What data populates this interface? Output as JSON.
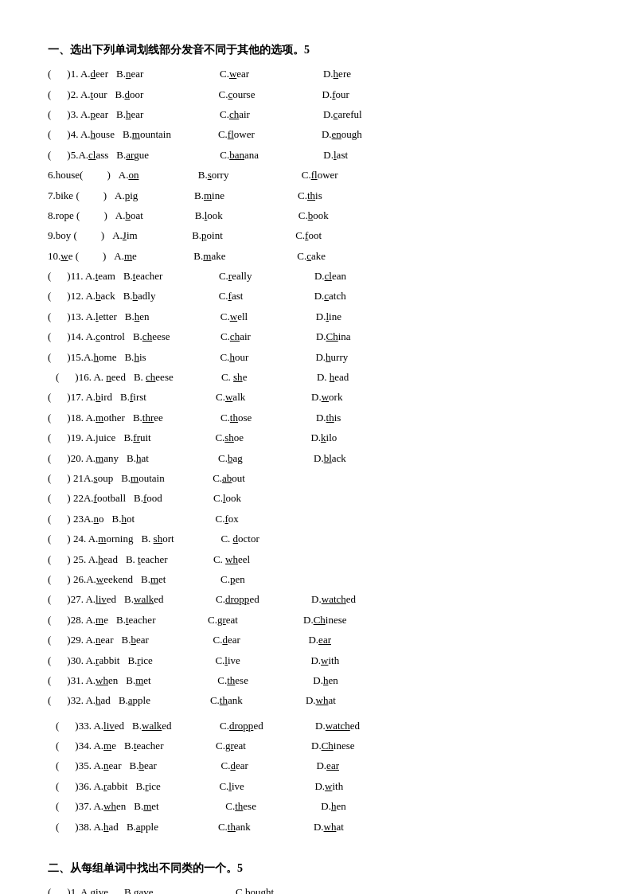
{
  "sections": [
    {
      "title": "一、选出下列单词划线部分发音不同于其他的选项。5",
      "questions": [
        {
          "num": "( )1.",
          "opts": [
            "A.<u>d</u>eer",
            "B.<u>n</u>ear",
            "C.<u>w</u>ear",
            "D.<u>h</u>ere"
          ]
        },
        {
          "num": "( )2.",
          "opts": [
            "A.<u>t</u>our",
            "B.<u>d</u>oor",
            "C.<u>c</u>ourse",
            "D.<u>f</u>our"
          ]
        },
        {
          "num": "( )3.",
          "opts": [
            "A.<u>p</u>ear",
            "B.<u>h</u>ear",
            "C.<u>ch</u>air",
            "D.<u>c</u>areful"
          ]
        },
        {
          "num": "( )4.",
          "opts": [
            "A.<u>h</u>ouse",
            "B.<u>m</u>ountain",
            "C.<u>fl</u>ower",
            "D.<u>en</u>ough"
          ]
        },
        {
          "num": "( )5.",
          "opts": [
            "A.<u>cl</u>ass",
            "B.<u>ar</u>gue",
            "C.<u>ban</u>ana",
            "D.<u>l</u>ast"
          ]
        },
        {
          "num": "6.house(   )",
          "opts": [
            "A.<u>on</u>",
            "B.<u>s</u>orry",
            "C.<u>fl</u>ower"
          ],
          "noD": true
        },
        {
          "num": "7.bike  (   )",
          "opts": [
            "A.<u>p</u>ig",
            "B.<u>m</u>ine",
            "C.<u>th</u>is"
          ],
          "noD": true
        },
        {
          "num": "8.rope  (   )",
          "opts": [
            "A.<u>b</u>oat",
            "B.<u>l</u>ook",
            "C.<u>b</u>ook"
          ],
          "noD": true
        },
        {
          "num": "9.boy   (   )",
          "opts": [
            "A.<u>J</u>im",
            "B.<u>p</u>oint",
            "C.<u>f</u>oot"
          ],
          "noD": true
        },
        {
          "num": "10.we  (   )",
          "opts": [
            "A.<u>m</u>e",
            "B.<u>m</u>ake",
            "C.<u>c</u>ake"
          ],
          "noD": true
        }
      ]
    }
  ]
}
